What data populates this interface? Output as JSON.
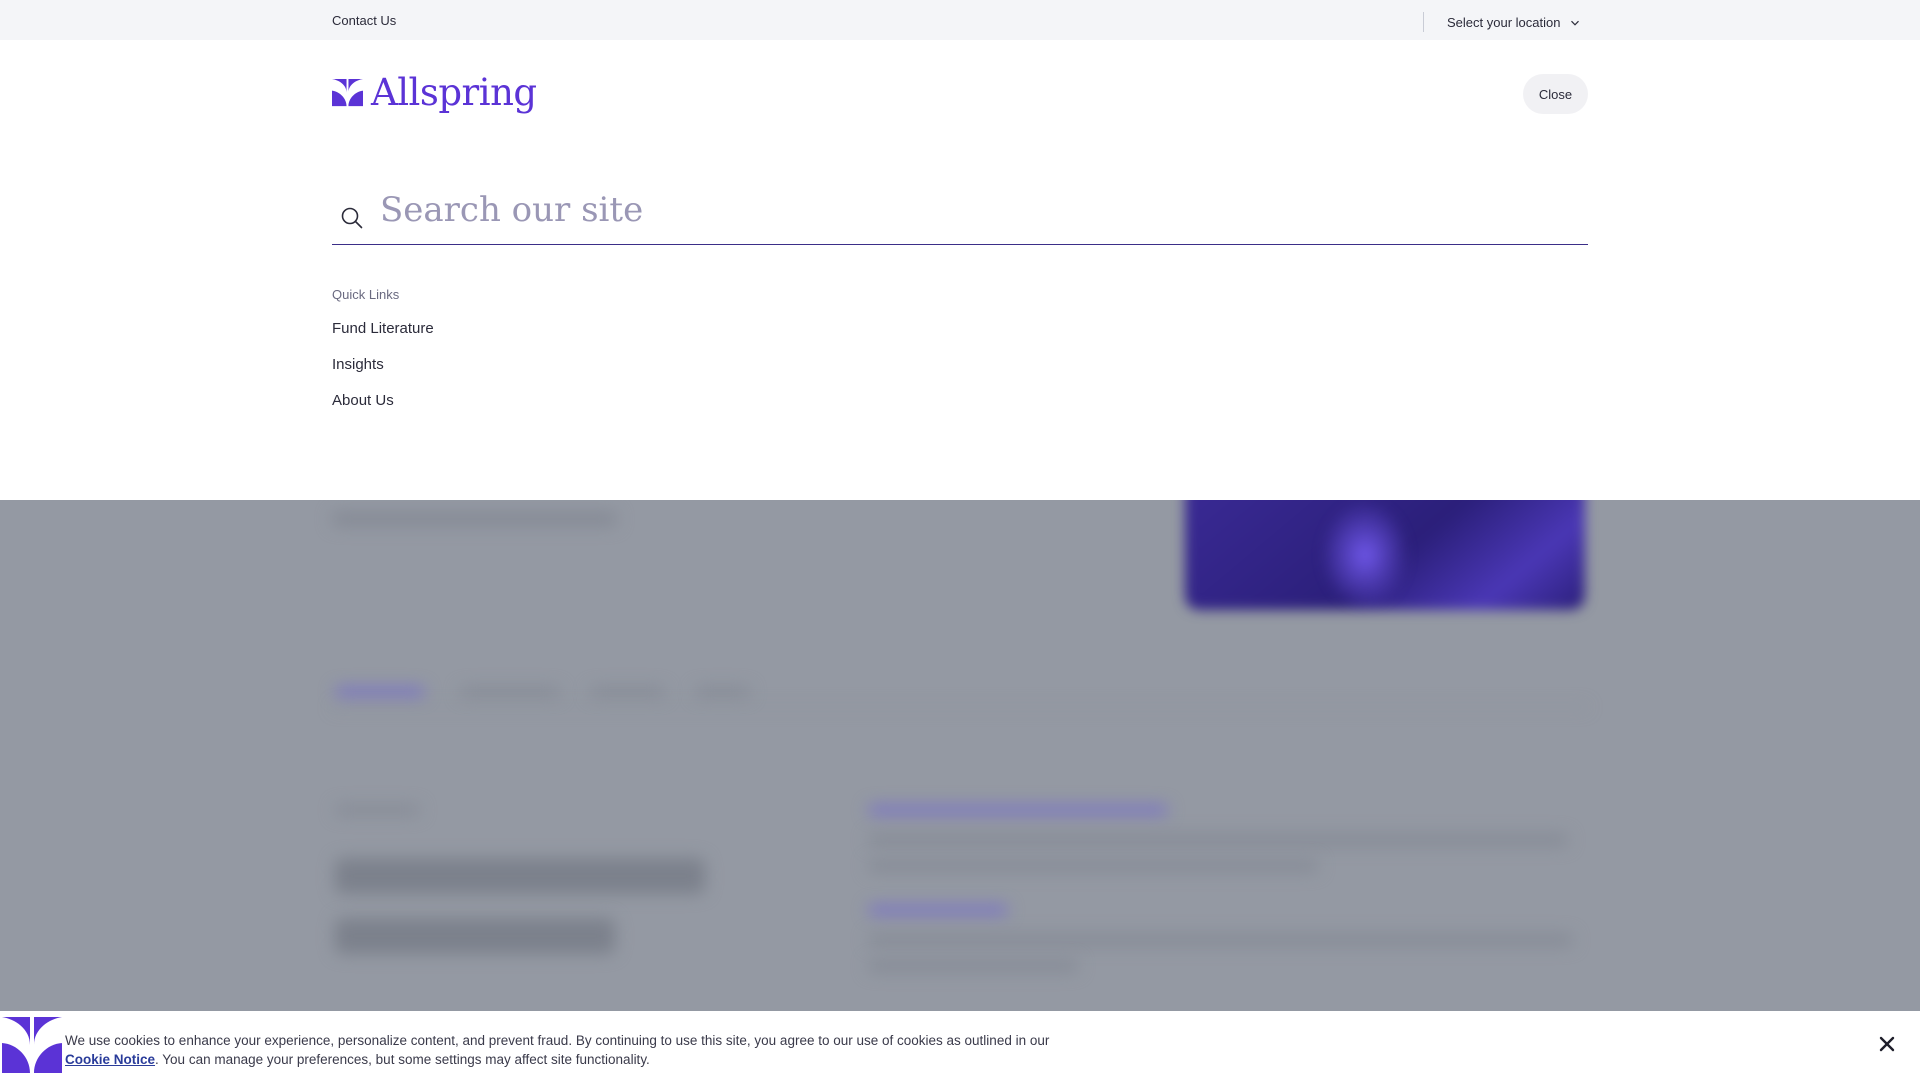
{
  "utility_bar": {
    "contact_label": "Contact Us",
    "location_label": "Select your location"
  },
  "header": {
    "logo_text": "Allspring",
    "close_label": "Close"
  },
  "search": {
    "placeholder": "Search our site"
  },
  "quick_links": {
    "title": "Quick Links",
    "items": [
      {
        "label": "Fund Literature"
      },
      {
        "label": "Insights"
      },
      {
        "label": "About Us"
      }
    ]
  },
  "cookie_banner": {
    "text_before": "We use cookies to enhance your experience, personalize content, and prevent fraud. By continuing to use this site, you agree to our use of cookies as outlined in our ",
    "link_label": "Cookie Notice",
    "text_after": ". You can manage your preferences, but some settings may affect site functionality."
  },
  "colors": {
    "brand_purple": "#5b33d6",
    "search_underline": "#3b2e88",
    "overlay_gray": "#9499a3",
    "utility_bg": "#f4f5f8"
  }
}
